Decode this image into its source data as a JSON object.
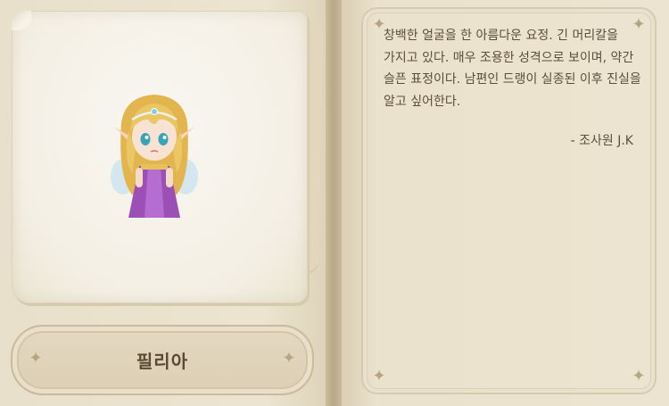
{
  "character": {
    "name": "필리아",
    "portrait": "fairy-portrait"
  },
  "description": {
    "text": "창백한 얼굴을 한 아름다운 요정. 긴 머리칼을 가지고 있다. 매우 조용한 성격으로 보이며, 약간 슬픈 표정이다. 남편인 드랭이 실종된 이후 진실을 알고 싶어한다.",
    "author": "- 조사원 J.K"
  },
  "colors": {
    "paper": "#f5f1e6",
    "book": "#ece4d0",
    "text": "#5d4e39",
    "dress": "#9c4fb5",
    "hair": "#e7c15c"
  }
}
